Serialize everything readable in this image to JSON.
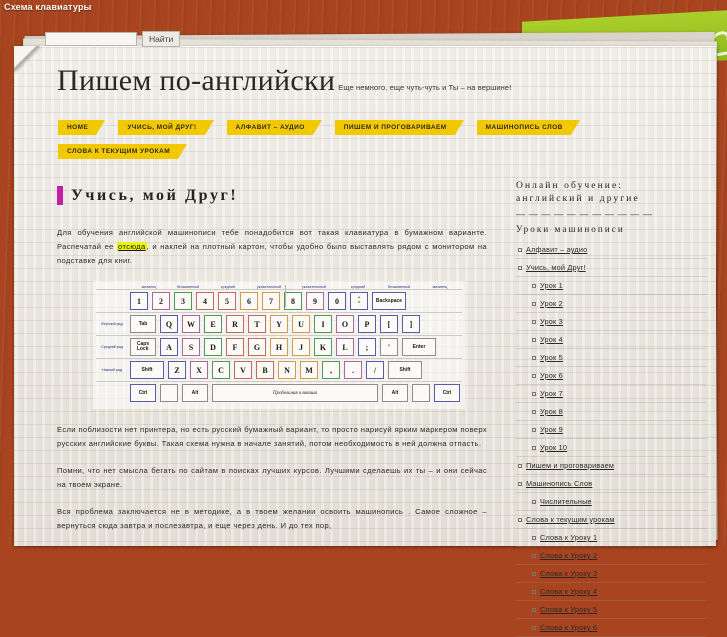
{
  "window": {
    "top_title": "Схема клавиатуры"
  },
  "search": {
    "value": "",
    "placeholder": "",
    "button_label": "Найти"
  },
  "header": {
    "site_title": "Пишем по-английски",
    "tagline": "Еще немного, еще чуть-чуть и Ты – на вершине!"
  },
  "nav": {
    "items": [
      {
        "label": "HOME"
      },
      {
        "label": "УЧИСЬ, МОЙ ДРУГ!"
      },
      {
        "label": "АЛФАВИТ – АУДИО"
      },
      {
        "label": "ПИШЕМ И ПРОГОВАРИВАЕМ"
      },
      {
        "label": "МАШИНОПИСЬ СЛОВ"
      },
      {
        "label": "СЛОВА К ТЕКУЩИМ УРОКАМ"
      }
    ]
  },
  "article": {
    "title": "Учись, мой Друг!",
    "p1_a": "Для обучения английской машинописи   тебе понадобится вот такая      клавиатура в бумажном варианте. Распечатай ее  ",
    "p1_link": "отсюда",
    "p1_b": ", и наклей на плотный картон, чтобы удобно было выставлять рядом с монитором на подставке для книг.",
    "p2": "Если поблизости нет принтера, но есть русский бумажный вариант, то просто нарисуй ярким маркером поверх русских  английские буквы. Такая схема нужна в начале занятий, потом необходимость в ней должна отпасть.",
    "p3": "Помни, что нет смысла бегать по сайтам в поисках   лучших курсов. Лучшими сделаешь их ты – и они сейчас на твоем экране.",
    "p4": "Вся проблема заключается не в методике, а в твоем желании       освоить машинопись . Самое сложное – вернуться сюда завтра и послезавтра, и еще через день. И до тех пор,"
  },
  "keyboard": {
    "fingers": [
      "мизинец",
      "безымянный",
      "средний",
      "указательный",
      "указательный",
      "средний",
      "безымянный",
      "мизинец"
    ],
    "row_labels": {
      "top": "Верхний ряд",
      "home": "Средний ряд",
      "bottom": "Нижний ряд"
    },
    "rows": {
      "numbers": [
        "1",
        "2",
        "3",
        "4",
        "5",
        "6",
        "7",
        "8",
        "9",
        "0",
        "+\n="
      ],
      "numbers_end": "Backspace",
      "qwerty_start": "Tab",
      "qwerty": [
        "Q",
        "W",
        "E",
        "R",
        "T",
        "Y",
        "U",
        "I",
        "O",
        "P",
        "[",
        "]"
      ],
      "home_start": "Caps\nLock",
      "home": [
        "A",
        "S",
        "D",
        "F",
        "G",
        "H",
        "J",
        "K",
        "L",
        ";",
        "'"
      ],
      "home_end": "Enter",
      "bottom_start": "Shift",
      "bottom": [
        "Z",
        "X",
        "C",
        "V",
        "B",
        "N",
        "M",
        ",",
        ".",
        "/"
      ],
      "bottom_end": "Shift",
      "mod_left": [
        "Ctrl",
        "",
        "Alt"
      ],
      "space_label": "Пробельная клавиша",
      "mod_right": [
        "Alt",
        "",
        "Ctrl"
      ]
    }
  },
  "sidebar": {
    "title_line1": "Онлайн обучение:",
    "title_line2": "английский и другие",
    "separator": "— — — — — — — — — — —",
    "subtitle": "Уроки машинописи",
    "items": [
      {
        "label": "Алфавит – аудио",
        "level": 0
      },
      {
        "label": "Учись, мой Друг!",
        "level": 0
      },
      {
        "label": "Урок 1",
        "level": 1
      },
      {
        "label": "Урок 2",
        "level": 1
      },
      {
        "label": "Урок 3",
        "level": 1
      },
      {
        "label": "Урок 4",
        "level": 1
      },
      {
        "label": "Урок 5",
        "level": 1
      },
      {
        "label": "Урок 6",
        "level": 1
      },
      {
        "label": "Урок 7",
        "level": 1
      },
      {
        "label": "Урок 8",
        "level": 1
      },
      {
        "label": "Урок 9",
        "level": 1
      },
      {
        "label": "Урок 10",
        "level": 1
      },
      {
        "label": "Пишем и проговариваем",
        "level": 0
      },
      {
        "label": "Машинопись Слов",
        "level": 0
      },
      {
        "label": "Числительные",
        "level": 1
      },
      {
        "label": "Слова к текущим урокам",
        "level": 0
      },
      {
        "label": "Слова к Уроку 1",
        "level": 1
      },
      {
        "label": "Слова к Уроку 2",
        "level": 1
      },
      {
        "label": "Слова к Уроку 3",
        "level": 1
      },
      {
        "label": "Слова к Уроку 4",
        "level": 1
      },
      {
        "label": "Слова к Уроку 5",
        "level": 1
      },
      {
        "label": "Слова к Уроку 6",
        "level": 1
      }
    ]
  },
  "colors": {
    "wood": "#a8441f",
    "nav_tab": "#f2c800",
    "accent_bar": "#c21fa8",
    "highlight": "#eaf20a",
    "ornament": "#9ec426"
  }
}
